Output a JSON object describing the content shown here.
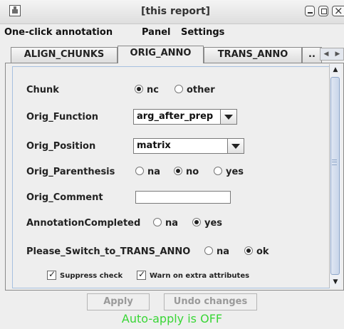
{
  "window": {
    "title": "[this report]"
  },
  "menu": [
    "One-click annotation",
    "Panel",
    "Settings"
  ],
  "tabs": [
    "ALIGN_CHUNKS",
    "ORIG_ANNO",
    "TRANS_ANNO",
    ".."
  ],
  "active_tab": "ORIG_ANNO",
  "form": {
    "chunk": {
      "label": "Chunk",
      "options": [
        "nc",
        "other"
      ],
      "selected": "nc"
    },
    "orig_function": {
      "label": "Orig_Function",
      "value": "arg_after_prep"
    },
    "orig_position": {
      "label": "Orig_Position",
      "value": "matrix"
    },
    "orig_parenthesis": {
      "label": "Orig_Parenthesis",
      "options": [
        "na",
        "no",
        "yes"
      ],
      "selected": "no"
    },
    "orig_comment": {
      "label": "Orig_Comment",
      "value": ""
    },
    "annotation_completed": {
      "label": "AnnotationCompleted",
      "options": [
        "na",
        "yes"
      ],
      "selected": "yes"
    },
    "please_switch": {
      "label": "Please_Switch_to_TRANS_ANNO",
      "options": [
        "na",
        "ok"
      ],
      "selected": "ok"
    }
  },
  "checks": {
    "suppress": "Suppress check",
    "warn": "Warn on extra attributes"
  },
  "buttons": {
    "apply": "Apply",
    "undo": "Undo changes"
  },
  "status": {
    "text": "Auto-apply is OFF",
    "color": "#39d636"
  }
}
